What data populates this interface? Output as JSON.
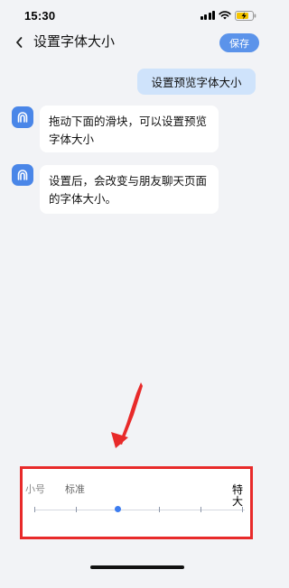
{
  "status_bar": {
    "time": "15:30",
    "icons": [
      "signal-icon",
      "wifi-icon",
      "battery-charging-icon"
    ]
  },
  "nav": {
    "back_icon": "chevron-left-icon",
    "title": "设置字体大小",
    "save_label": "保存"
  },
  "chat": {
    "user_message": "设置预览字体大小",
    "bot_avatar_icon": "bot-avatar-icon",
    "bot_messages": [
      "拖动下面的滑块，可以设置预览字体大小",
      "设置后，会改变与朋友聊天页面的字体大小。"
    ]
  },
  "font_size_panel": {
    "labels": {
      "small": "小号",
      "standard": "标准",
      "extra_large": "特大"
    },
    "slider": {
      "tick_count": 6,
      "selected_index": 2
    }
  },
  "annotation": {
    "arrow_color": "#e82a2a",
    "highlight_color": "#e82a2a"
  },
  "colors": {
    "accent": "#5b93ea",
    "user_bubble": "#cfe3fb",
    "background": "#f2f3f6"
  }
}
